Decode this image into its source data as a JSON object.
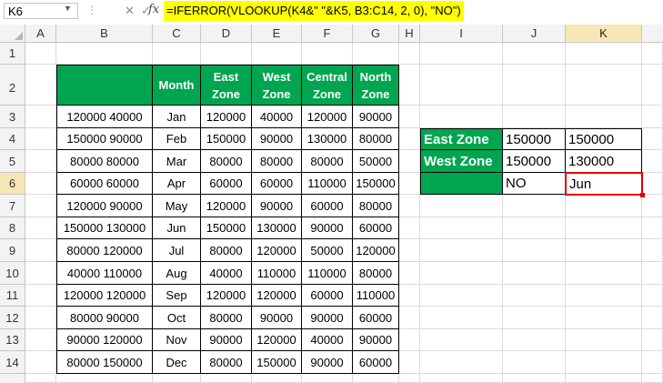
{
  "formula_bar": {
    "name_box": "K6",
    "fx_symbol": "fx",
    "formula": "=IFERROR(VLOOKUP(K4&\" \"&K5, B3:C14, 2, 0), \"NO\")"
  },
  "columns": [
    "A",
    "B",
    "C",
    "D",
    "E",
    "F",
    "G",
    "H",
    "I",
    "J",
    "K"
  ],
  "rows": [
    "1",
    "2",
    "3",
    "4",
    "5",
    "6",
    "7",
    "8",
    "9",
    "10",
    "11",
    "12",
    "13",
    "14"
  ],
  "table": {
    "headers": {
      "month": "Month",
      "east": [
        "East",
        "Zone"
      ],
      "west": [
        "West",
        "Zone"
      ],
      "central": [
        "Central",
        "Zone"
      ],
      "north": [
        "North",
        "Zone"
      ]
    },
    "rows": [
      {
        "key": "120000 40000",
        "month": "Jan",
        "east": "120000",
        "west": "40000",
        "central": "120000",
        "north": "90000"
      },
      {
        "key": "150000 90000",
        "month": "Feb",
        "east": "150000",
        "west": "90000",
        "central": "130000",
        "north": "80000"
      },
      {
        "key": "80000 80000",
        "month": "Mar",
        "east": "80000",
        "west": "80000",
        "central": "80000",
        "north": "50000"
      },
      {
        "key": "60000 60000",
        "month": "Apr",
        "east": "60000",
        "west": "60000",
        "central": "110000",
        "north": "150000"
      },
      {
        "key": "120000 90000",
        "month": "May",
        "east": "120000",
        "west": "90000",
        "central": "60000",
        "north": "80000"
      },
      {
        "key": "150000 130000",
        "month": "Jun",
        "east": "150000",
        "west": "130000",
        "central": "90000",
        "north": "60000"
      },
      {
        "key": "80000 120000",
        "month": "Jul",
        "east": "80000",
        "west": "120000",
        "central": "50000",
        "north": "120000"
      },
      {
        "key": "40000 110000",
        "month": "Aug",
        "east": "40000",
        "west": "110000",
        "central": "110000",
        "north": "80000"
      },
      {
        "key": "120000 120000",
        "month": "Sep",
        "east": "120000",
        "west": "120000",
        "central": "60000",
        "north": "110000"
      },
      {
        "key": "80000 90000",
        "month": "Oct",
        "east": "80000",
        "west": "90000",
        "central": "90000",
        "north": "60000"
      },
      {
        "key": "90000 120000",
        "month": "Nov",
        "east": "90000",
        "west": "120000",
        "central": "40000",
        "north": "90000"
      },
      {
        "key": "80000 150000",
        "month": "Dec",
        "east": "80000",
        "west": "150000",
        "central": "90000",
        "north": "60000"
      }
    ]
  },
  "lookup": {
    "east_label": "East Zone",
    "west_label": "West Zone",
    "east_j": "150000",
    "east_k": "150000",
    "west_j": "150000",
    "west_k": "130000",
    "result_j": "NO",
    "result_k": "Jun"
  },
  "colors": {
    "header_green": "#00a550",
    "formula_highlight": "#ffff00",
    "selection_red": "#e00000"
  }
}
